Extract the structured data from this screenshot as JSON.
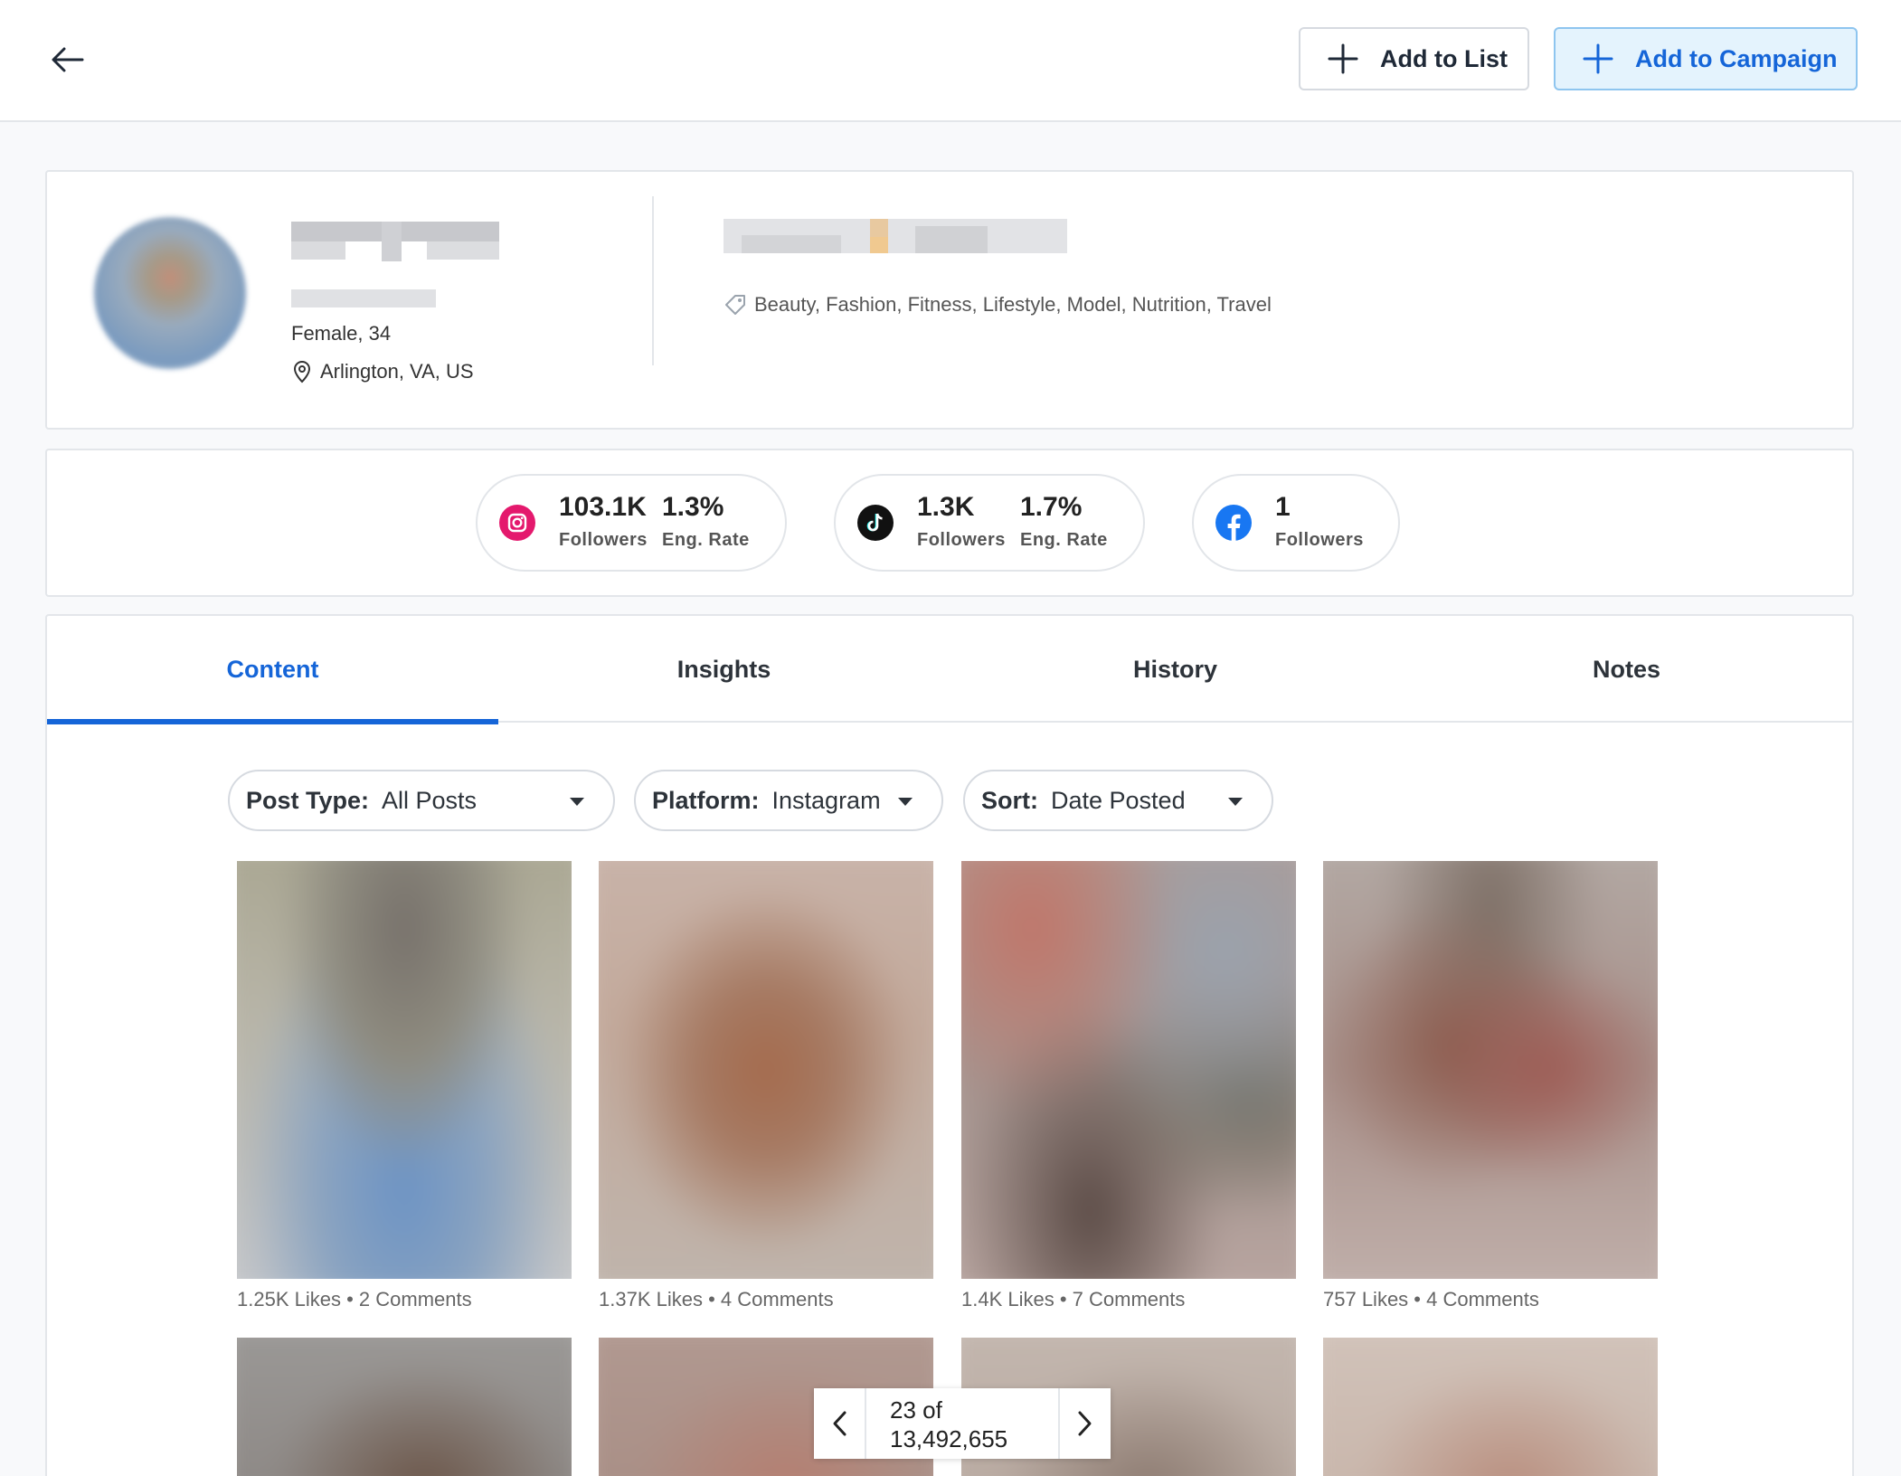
{
  "header": {
    "add_to_list_label": "Add to List",
    "add_to_campaign_label": "Add to Campaign"
  },
  "profile": {
    "demographics": "Female, 34",
    "location": "Arlington, VA, US",
    "categories": "Beauty, Fashion, Fitness, Lifestyle, Model, Nutrition, Travel"
  },
  "platform_stats": [
    {
      "platform_icon": "instagram-icon",
      "followers": "103.1K",
      "followers_label": "Followers",
      "eng_rate": "1.3%",
      "eng_rate_label": "Eng. Rate"
    },
    {
      "platform_icon": "tiktok-icon",
      "followers": "1.3K",
      "followers_label": "Followers",
      "eng_rate": "1.7%",
      "eng_rate_label": "Eng. Rate"
    },
    {
      "platform_icon": "facebook-icon",
      "followers": "1",
      "followers_label": "Followers"
    }
  ],
  "tabs": [
    {
      "label": "Content",
      "active": true
    },
    {
      "label": "Insights",
      "active": false
    },
    {
      "label": "History",
      "active": false
    },
    {
      "label": "Notes",
      "active": false
    }
  ],
  "filters": [
    {
      "key": "Post Type:",
      "value": "All Posts"
    },
    {
      "key": "Platform:",
      "value": "Instagram"
    },
    {
      "key": "Sort:",
      "value": "Date Posted"
    }
  ],
  "posts": [
    {
      "likes": "1.25K Likes",
      "comments": "2 Comments"
    },
    {
      "likes": "1.37K Likes",
      "comments": "4 Comments"
    },
    {
      "likes": "1.4K Likes",
      "comments": "7 Comments"
    },
    {
      "likes": "757 Likes",
      "comments": "4 Comments"
    }
  ],
  "pager": {
    "line1": "23 of",
    "line2": "13,492,655"
  },
  "colors": {
    "accent": "#1565d8",
    "instagram": "#e4196d",
    "facebook": "#1877f2"
  }
}
